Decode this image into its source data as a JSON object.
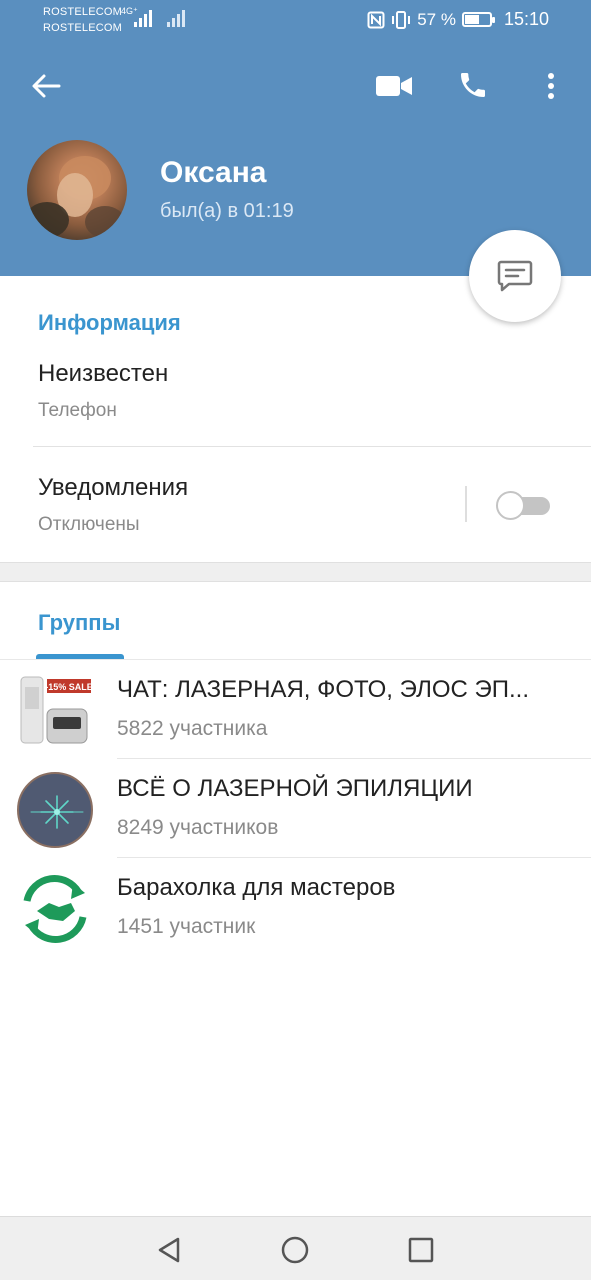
{
  "status_bar": {
    "operator1": "ROSTELECOM",
    "operator2": "ROSTELECOM",
    "network": "4G⁺",
    "battery_text": "57 %",
    "battery_level": 0.57,
    "time": "15:10"
  },
  "profile": {
    "name": "Оксана",
    "last_seen": "был(а) в 01:19"
  },
  "info": {
    "section_title": "Информация",
    "phone_value": "Неизвестен",
    "phone_label": "Телефон",
    "notifications_title": "Уведомления",
    "notifications_state": "Отключены",
    "notifications_enabled": false
  },
  "groups": {
    "section_title": "Группы",
    "items": [
      {
        "title": "ЧАТ: ЛАЗЕРНАЯ, ФОТО, ЭЛОС ЭП...",
        "members": "5822 участника",
        "badge": "-15% SALE"
      },
      {
        "title": "ВСЁ О ЛАЗЕРНОЙ ЭПИЛЯЦИИ",
        "members": "8249 участников"
      },
      {
        "title": "Барахолка для мастеров",
        "members": "1451 участник"
      }
    ]
  },
  "icons": {
    "back": "arrow-left-icon",
    "video": "video-camera-icon",
    "call": "phone-icon",
    "more": "more-vertical-icon",
    "message": "message-icon",
    "nav_back": "triangle-back-icon",
    "nav_home": "circle-home-icon",
    "nav_recents": "square-recents-icon"
  },
  "colors": {
    "header": "#5a8fbf",
    "accent": "#3a95cf",
    "toggle_off": "#c4c4c4"
  }
}
